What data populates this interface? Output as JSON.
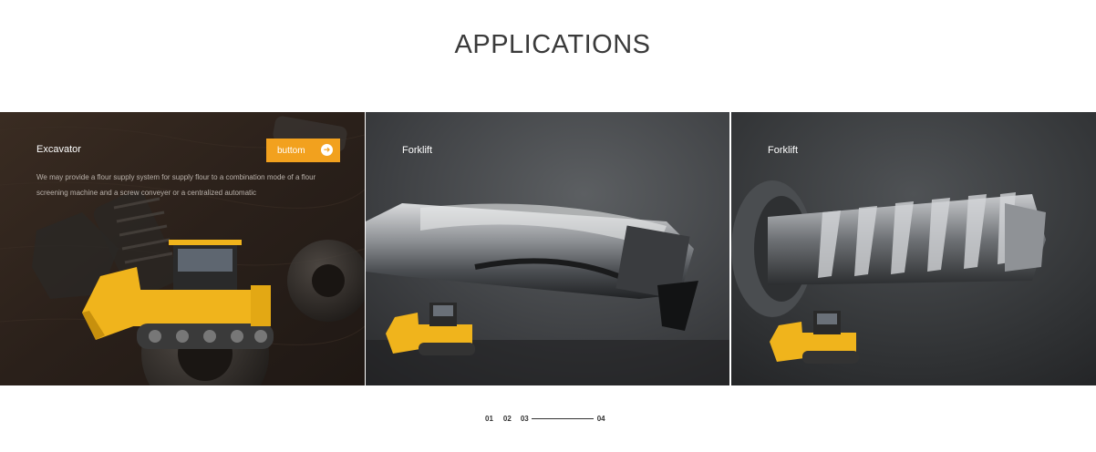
{
  "section": {
    "title": "APPLICATIONS"
  },
  "cards": [
    {
      "title": "Excavator",
      "button": "buttom",
      "description": "We may provide a flour supply system for supply flour to a combination mode of a flour screening machine and a screw conveyer or a centralized automatic"
    },
    {
      "title": "Forklift"
    },
    {
      "title": "Forklift"
    }
  ],
  "pagination": {
    "p1": "01",
    "p2": "02",
    "p3": "03",
    "p4": "04",
    "active": "04"
  },
  "colors": {
    "accent": "#f2a11e",
    "bulldozer": "#f0b41c"
  },
  "icons": {
    "more": "arrow-right-circle-icon"
  }
}
